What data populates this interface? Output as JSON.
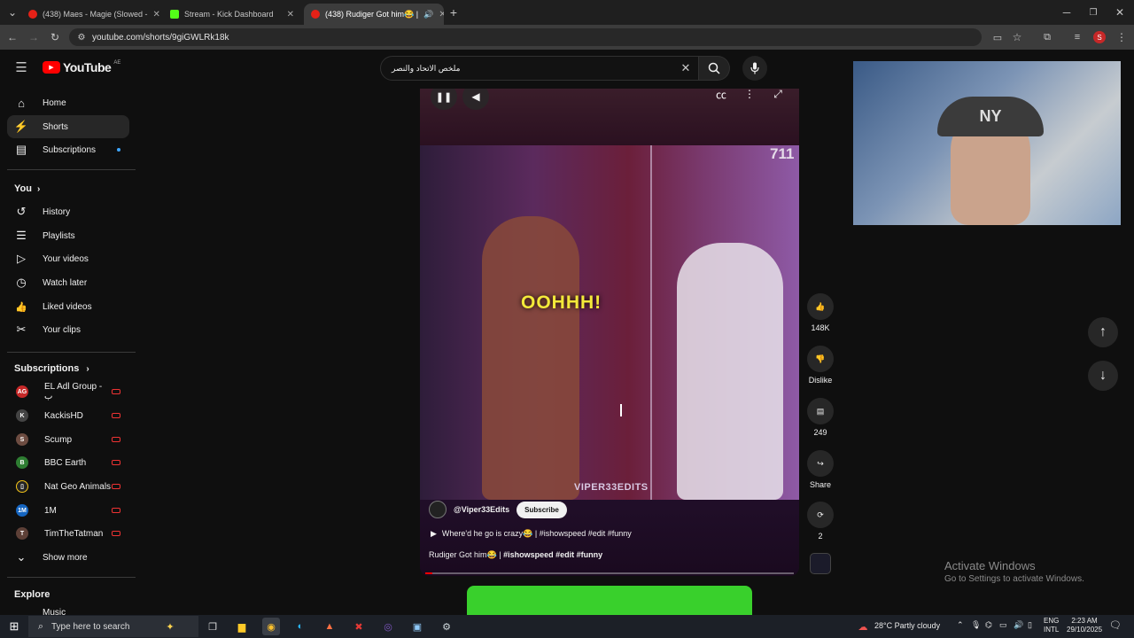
{
  "browser": {
    "tabs": [
      {
        "title": "(438) Maes - Magie (Slowed -",
        "favicon_color": "#e62117"
      },
      {
        "title": "Stream - Kick Dashboard",
        "favicon_color": "#53fc18"
      },
      {
        "title": "(438) Rudiger Got him😂 |",
        "favicon_color": "#e62117"
      }
    ],
    "url": "youtube.com/shorts/9giGWLRk18k",
    "profile_initial": "S"
  },
  "youtube": {
    "logo_text": "YouTube",
    "region": "AE",
    "search_value": "ملخص الاتحاد والنصر",
    "nav": [
      {
        "label": "Home",
        "icon": "home-icon",
        "glyph": "⌂"
      },
      {
        "label": "Shorts",
        "icon": "shorts-icon",
        "glyph": "⚡"
      },
      {
        "label": "Subscriptions",
        "icon": "subscriptions-icon",
        "glyph": "▤"
      }
    ],
    "you_heading": "You",
    "you_items": [
      {
        "label": "History",
        "icon": "history-icon",
        "glyph": "↺"
      },
      {
        "label": "Playlists",
        "icon": "playlists-icon",
        "glyph": "☰"
      },
      {
        "label": "Your videos",
        "icon": "your-videos-icon",
        "glyph": "▷"
      },
      {
        "label": "Watch later",
        "icon": "watch-later-icon",
        "glyph": "◷"
      },
      {
        "label": "Liked videos",
        "icon": "liked-videos-icon",
        "glyph": "👍"
      },
      {
        "label": "Your clips",
        "icon": "clips-icon",
        "glyph": "✂"
      }
    ],
    "subscriptions_heading": "Subscriptions",
    "subscriptions": [
      {
        "label": "EL Adl Group - ب",
        "avatar_color": "#c62828",
        "avatar_text": "AG"
      },
      {
        "label": "KackisHD",
        "avatar_color": "#444444",
        "avatar_text": "K"
      },
      {
        "label": "Scump",
        "avatar_color": "#6d4c41",
        "avatar_text": "S"
      },
      {
        "label": "BBC Earth",
        "avatar_color": "#2e7d32",
        "avatar_text": "B"
      },
      {
        "label": "Nat Geo Animals",
        "avatar_color": "#222222",
        "avatar_text": "▯"
      },
      {
        "label": "1M",
        "avatar_color": "#1565c0",
        "avatar_text": "1M"
      },
      {
        "label": "TimTheTatman",
        "avatar_color": "#5d4037",
        "avatar_text": "T"
      }
    ],
    "show_more": "Show more",
    "explore_heading": "Explore",
    "explore_first": "Music"
  },
  "short": {
    "overlay_counter": "711",
    "caption_text": "OOHHH!",
    "watermark": "VIPER33EDITS",
    "channel": "@Viper33Edits",
    "subscribe_label": "Subscribe",
    "linked_video": "Where'd he go is crazy😂 | #ishowspeed #edit #funny",
    "title_plain": "Rudiger Got him😂 | ",
    "title_tags": "#ishowspeed #edit #funny",
    "progress": 0.02
  },
  "actions": {
    "likes": "148K",
    "dislike_label": "Dislike",
    "comments": "249",
    "share_label": "Share",
    "remix_count": "2"
  },
  "watermark": {
    "title": "Activate Windows",
    "subtitle": "Go to Settings to activate Windows."
  },
  "taskbar": {
    "search_placeholder": "Type here to search",
    "weather": "28°C  Partly cloudy",
    "lang_top": "ENG",
    "lang_bottom": "INTL",
    "time": "2:23 AM",
    "date": "29/10/2025"
  }
}
